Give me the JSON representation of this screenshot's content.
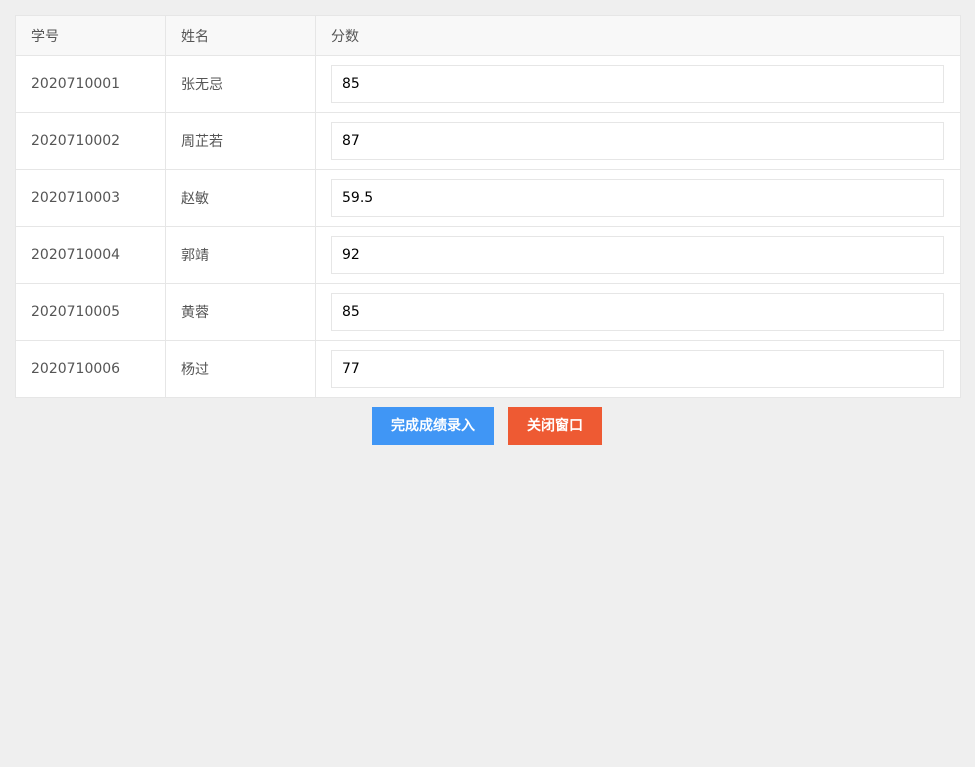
{
  "table": {
    "headers": [
      "学号",
      "姓名",
      "分数"
    ],
    "rows": [
      {
        "id": "2020710001",
        "name": "张无忌",
        "score": "85"
      },
      {
        "id": "2020710002",
        "name": "周芷若",
        "score": "87"
      },
      {
        "id": "2020710003",
        "name": "赵敏",
        "score": "59.5"
      },
      {
        "id": "2020710004",
        "name": "郭靖",
        "score": "92"
      },
      {
        "id": "2020710005",
        "name": "黄蓉",
        "score": "85"
      },
      {
        "id": "2020710006",
        "name": "杨过",
        "score": "77"
      }
    ]
  },
  "actions": {
    "submit_label": "完成成绩录入",
    "close_label": "关闭窗口"
  },
  "colors": {
    "submit": "#4096f5",
    "close": "#ee5a33",
    "background": "#efefef"
  }
}
